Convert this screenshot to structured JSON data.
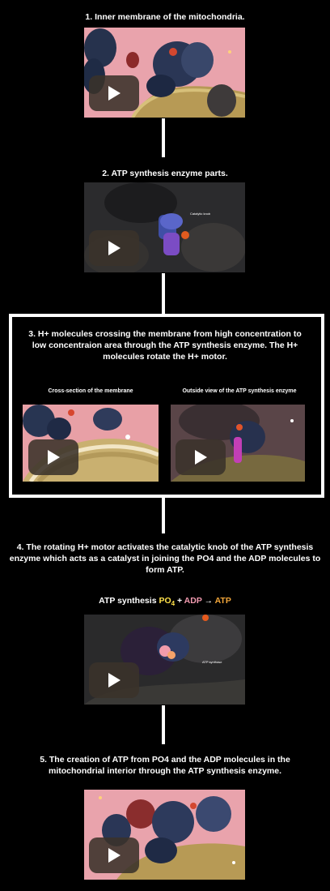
{
  "steps": [
    {
      "caption": "1. Inner membrane of the mitochondria."
    },
    {
      "caption": "2. ATP synthesis enzyme parts.",
      "video_label": "Catalytic knob"
    },
    {
      "caption": "3. H+ molecules crossing the membrane from high concentration to low concentraion area through the ATP synthesis enzyme. The H+ molecules rotate the H+ motor.",
      "left_title": "Cross-section of the membrane",
      "right_title": "Outside view of the ATP synthesis enzyme"
    },
    {
      "caption": "4. The rotating H+ motor activates the catalytic knob of the ATP synthesis enzyme which acts as a catalyst in joining the PO4 and the ADP molecules to form ATP.",
      "video_label": "ATP synthase"
    },
    {
      "caption": "5. The creation of ATP from PO4 and the ADP molecules in the mitochondrial interior through the ATP synthesis enzyme."
    }
  ],
  "reaction": {
    "lead": "ATP synthesis",
    "po4": "PO",
    "po4_sub": "4",
    "plus": "+",
    "adp": "ADP",
    "arrow": "→",
    "atp": "ATP"
  },
  "colors": {
    "background": "#000000",
    "po4": "#ffe14a",
    "adp": "#f29bb0",
    "atp": "#f2a63a",
    "frame": "#ffffff"
  },
  "icons": {
    "play": "play-icon"
  }
}
